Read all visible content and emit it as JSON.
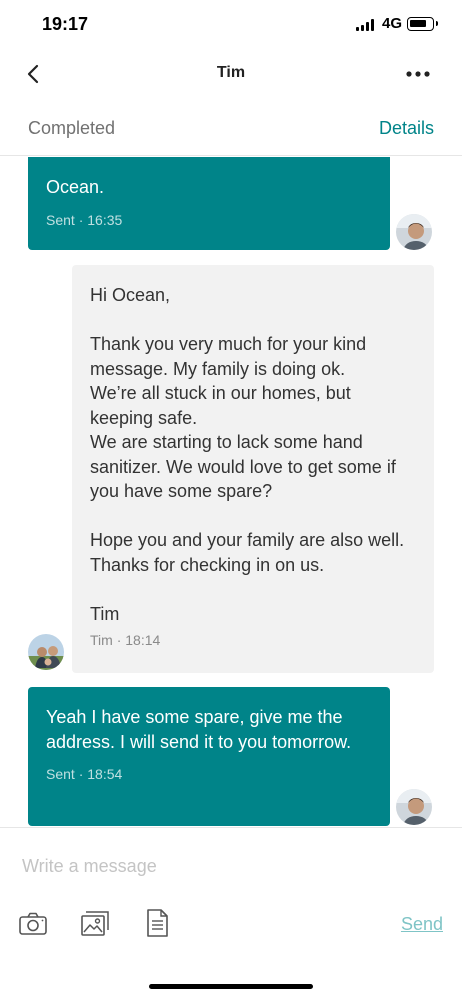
{
  "status_bar": {
    "time": "19:17",
    "network": "4G"
  },
  "nav": {
    "title": "Tim",
    "back_icon": "chevron-left-icon",
    "more_icon": "ellipsis-icon"
  },
  "reservation": {
    "status": "Completed",
    "details_label": "Details"
  },
  "messages": [
    {
      "direction": "sent",
      "text": "Ocean.",
      "meta": "Sent · 16:35"
    },
    {
      "direction": "received",
      "text": "Hi Ocean,\n\nThank you very much for your kind message. My family is doing ok.\nWe’re all stuck in our homes, but keeping safe.\nWe are starting to lack some hand sanitizer. We would love to get some if you have some spare?\n\nHope you and your family are also well. Thanks for checking in on us.\n\nTim",
      "meta": "Tim · 18:14"
    },
    {
      "direction": "sent",
      "text": "Yeah I have some spare, give me the address. I will send it to you tomorrow.",
      "meta": "Sent · 18:54"
    }
  ],
  "composer": {
    "placeholder": "Write a message",
    "send_label": "Send",
    "tools": [
      "camera-icon",
      "photo-library-icon",
      "document-icon"
    ]
  },
  "colors": {
    "accent": "#008489",
    "received_bubble": "#f2f2f2",
    "send_disabled": "#7fc4c6"
  }
}
